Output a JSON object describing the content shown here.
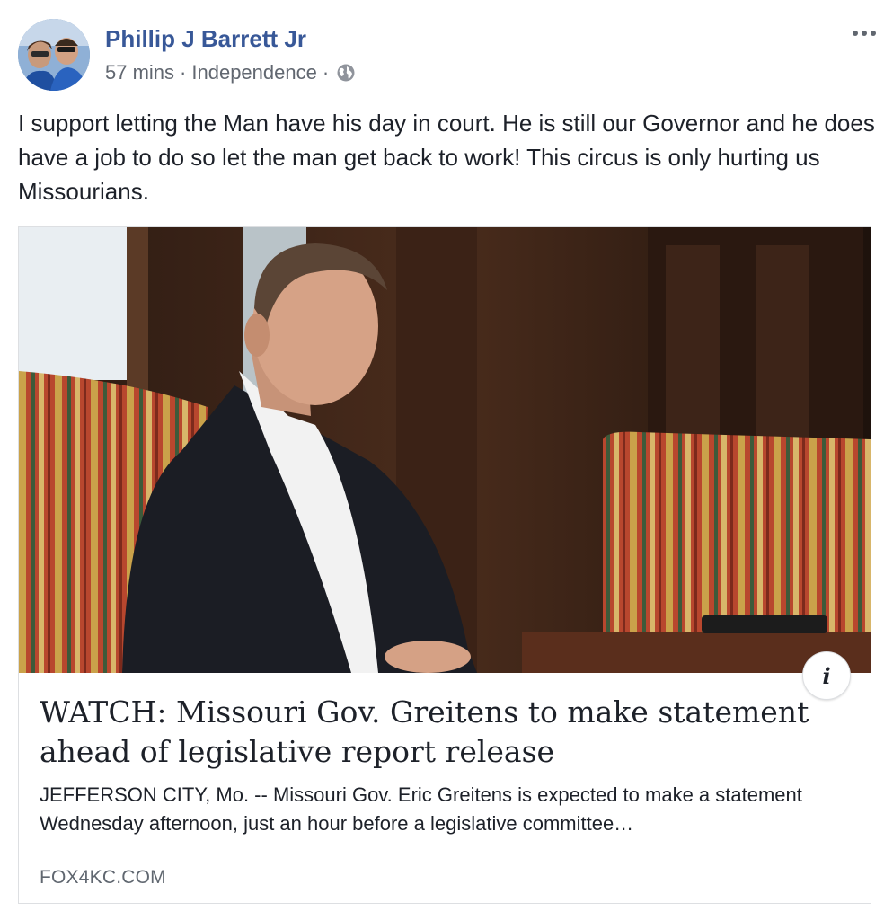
{
  "post": {
    "author": "Phillip J Barrett Jr",
    "time": "57 mins",
    "location": "Independence",
    "separator": "·",
    "privacy_icon": "globe-icon",
    "more_icon": "more-options-icon",
    "text": "I support letting the Man have his day in court. He is still our Governor and he does have a job to do so let the man get back to work! This circus is only hurting us Missourians."
  },
  "link_card": {
    "headline": "WATCH: Missouri Gov. Greitens to make statement ahead of legislative report release",
    "description": "JEFFERSON CITY, Mo. -- Missouri Gov. Eric Greitens is expected to make a statement Wednesday afternoon, just an hour before a legislative committee…",
    "domain": "FOX4KC.COM",
    "info_label": "i"
  },
  "colors": {
    "author_link": "#385898",
    "text": "#1d2129",
    "meta": "#616770",
    "border": "#dddfe2"
  }
}
